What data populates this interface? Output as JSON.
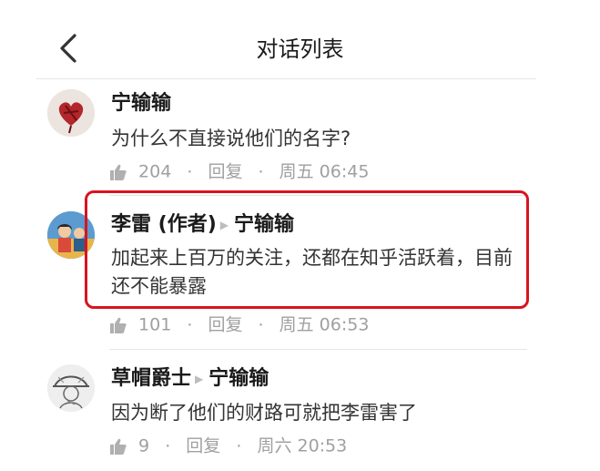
{
  "header": {
    "title": "对话列表",
    "back_icon": "chevron-left-icon"
  },
  "accent_colors": {
    "highlight_border": "#d8141e",
    "meta_gray": "#a0a0a0"
  },
  "comments": [
    {
      "author": "宁输输",
      "reply_to": "",
      "text": "为什么不直接说他们的名字?",
      "likes": "204",
      "reply_label": "回复",
      "time": "周五 06:45"
    },
    {
      "author": "李雷 (作者)",
      "reply_to": "宁输输",
      "text": "加起来上百万的关注，还都在知乎活跃着，目前还不能暴露",
      "likes": "101",
      "reply_label": "回复",
      "time": "周五 06:53"
    },
    {
      "author": "草帽爵士",
      "reply_to": "宁输输",
      "text": "因为断了他们的财路可就把李雷害了",
      "likes": "9",
      "reply_label": "回复",
      "time": "周六 20:53"
    }
  ]
}
